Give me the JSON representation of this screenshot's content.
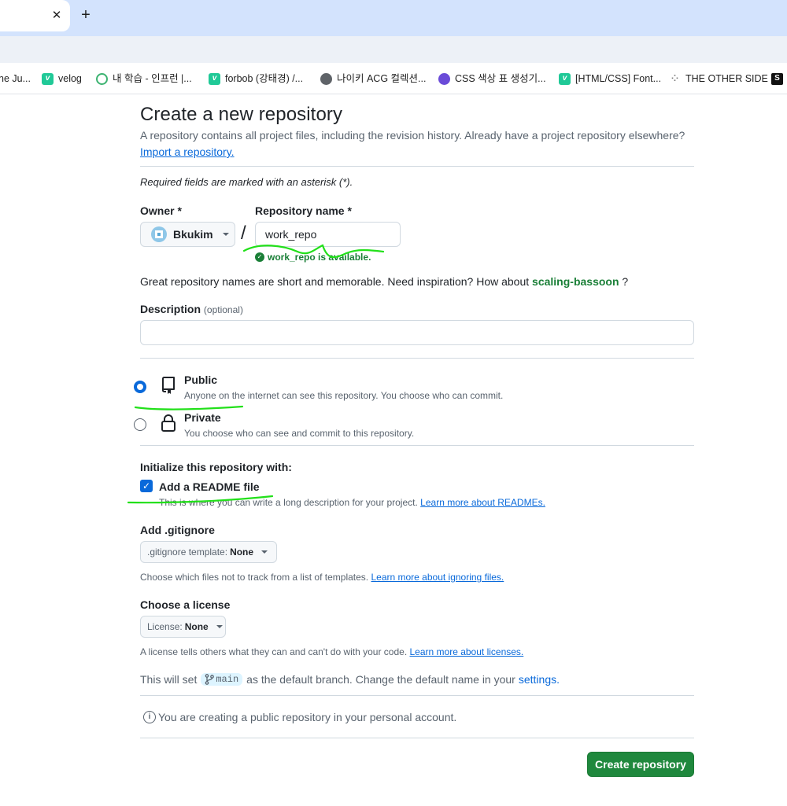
{
  "browser": {
    "tab_close_glyph": "✕",
    "new_tab_glyph": "+",
    "bookmarks": [
      {
        "label": "ne Ju...",
        "icon": "none"
      },
      {
        "label": "velog",
        "icon": "velog-icon"
      },
      {
        "label": "내 학습 - 인프런 |...",
        "icon": "inflearn-icon"
      },
      {
        "label": "forbob (강태경) /...",
        "icon": "velog-icon"
      },
      {
        "label": "나이키 ACG 컬렉션...",
        "icon": "globe-icon"
      },
      {
        "label": "CSS 색상 표 생성기...",
        "icon": "owl-icon"
      },
      {
        "label": "[HTML/CSS] Font...",
        "icon": "velog-icon"
      },
      {
        "label": "THE OTHER SIDE",
        "icon": "dot-icon"
      },
      {
        "label": "",
        "icon": "s-icon"
      }
    ]
  },
  "page": {
    "title": "Create a new repository",
    "subtitle": "A repository contains all project files, including the revision history. Already have a project repository elsewhere?",
    "import_link": "Import a repository.",
    "required_note": "Required fields are marked with an asterisk (*).",
    "owner_label": "Owner *",
    "owner_value": "Bkukim",
    "slash": "/",
    "repo_name_label": "Repository name *",
    "repo_name_value": "work_repo",
    "availability": "work_repo is available.",
    "great_names": "Great repository names are short and memorable. Need inspiration? How about",
    "suggestion": "scaling-bassoon",
    "suggestion_suffix": " ?",
    "description_label": "Description",
    "description_optional": "(optional)",
    "description_value": "",
    "visibility": [
      {
        "title": "Public",
        "desc": "Anyone on the internet can see this repository. You choose who can commit.",
        "checked": true
      },
      {
        "title": "Private",
        "desc": "You choose who can see and commit to this repository.",
        "checked": false
      }
    ],
    "init_label": "Initialize this repository with:",
    "readme_label": "Add a README file",
    "readme_checked": true,
    "readme_desc": "This is where you can write a long description for your project.",
    "readme_link": "Learn more about READMEs.",
    "gitignore_label": "Add .gitignore",
    "gitignore_select_prefix": ".gitignore template:",
    "gitignore_select_value": "None",
    "gitignore_help": "Choose which files not to track from a list of templates.",
    "gitignore_link": "Learn more about ignoring files.",
    "license_label": "Choose a license",
    "license_select_prefix": "License:",
    "license_select_value": "None",
    "license_help": "A license tells others what they can and can't do with your code.",
    "license_link": "Learn more about licenses.",
    "branch_prefix": "This will set",
    "branch_name": "main",
    "branch_suffix": "as the default branch. Change the default name in your",
    "branch_settings_link": "settings.",
    "info_text": "You are creating a public repository in your personal account.",
    "create_button": "Create repository"
  },
  "colors": {
    "primary_button": "#1f883d",
    "link": "#0969da",
    "success": "#1a7f37",
    "annotation": "#22e01a"
  }
}
